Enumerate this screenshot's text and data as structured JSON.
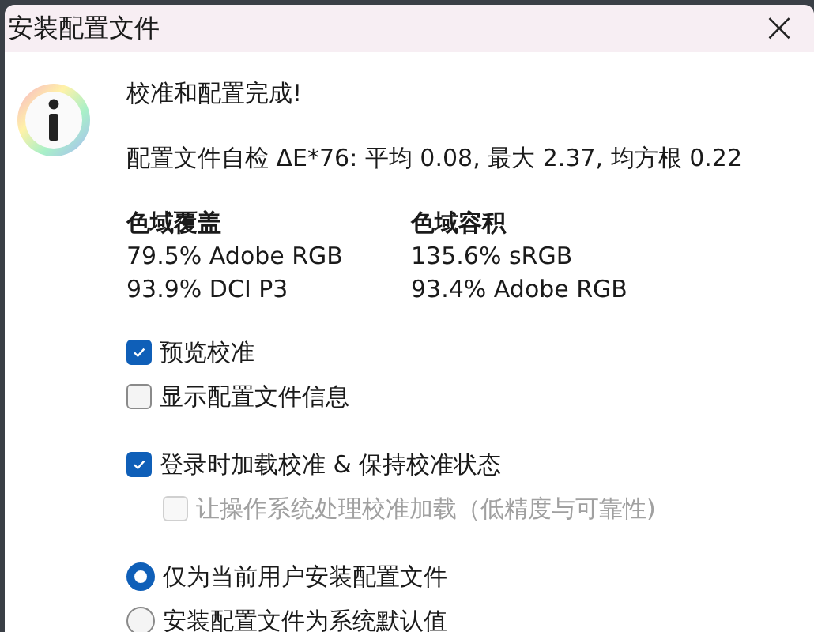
{
  "window": {
    "title": "安装配置文件",
    "close": "×"
  },
  "message": {
    "heading": "校准和配置完成!",
    "self_check": "配置文件自检 ΔE*76: 平均 0.08, 最大 2.37, 均方根 0.22"
  },
  "gamut": [
    {
      "title": "色域覆盖",
      "values": [
        "79.5% Adobe RGB",
        "93.9% DCI P3"
      ]
    },
    {
      "title": "色域容积",
      "values": [
        "135.6% sRGB",
        "93.4% Adobe RGB"
      ]
    }
  ],
  "option_groups": [
    [
      {
        "kind": "checkbox",
        "label": "预览校准",
        "checked": true,
        "disabled": false
      },
      {
        "kind": "checkbox",
        "label": "显示配置文件信息",
        "checked": false,
        "disabled": false
      }
    ],
    [
      {
        "kind": "checkbox",
        "label": "登录时加载校准 & 保持校准状态",
        "checked": true,
        "disabled": false,
        "children": [
          {
            "kind": "checkbox",
            "label": "让操作系统处理校准加载（低精度与可靠性)",
            "checked": false,
            "disabled": true
          }
        ]
      }
    ],
    [
      {
        "kind": "radio",
        "label": "仅为当前用户安装配置文件",
        "selected": true,
        "disabled": false
      },
      {
        "kind": "radio",
        "label": "安装配置文件为系统默认值",
        "selected": false,
        "disabled": false
      }
    ]
  ]
}
